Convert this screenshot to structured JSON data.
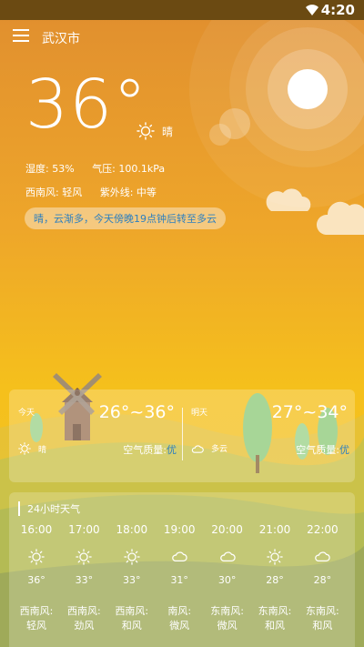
{
  "status": {
    "time": "4:20"
  },
  "header": {
    "city": "武汉市"
  },
  "current": {
    "temperature": "36°",
    "condition": "晴",
    "humidity": "湿度: 53%",
    "pressure": "气压: 100.1kPa",
    "wind": "西南风: 轻风",
    "uv": "紫外线: 中等",
    "tip": "晴，云渐多，今天傍晚19点钟后转至多云"
  },
  "today": {
    "label": "今天",
    "range": "26°~36°",
    "condition": "晴",
    "aq_label": "空气质量:",
    "aq_value": "优"
  },
  "tomorrow": {
    "label": "明天",
    "range": "27°~34°",
    "condition": "多云",
    "aq_label": "空气质量:",
    "aq_value": "优"
  },
  "hourly": {
    "title": "24小时天气",
    "items": [
      {
        "time": "16:00",
        "icon": "sun-icon",
        "temp": "36°",
        "wind_dir": "西南风:",
        "wind_lvl": "轻风"
      },
      {
        "time": "17:00",
        "icon": "sun-icon",
        "temp": "33°",
        "wind_dir": "西南风:",
        "wind_lvl": "劲风"
      },
      {
        "time": "18:00",
        "icon": "sun-icon",
        "temp": "33°",
        "wind_dir": "西南风:",
        "wind_lvl": "和风"
      },
      {
        "time": "19:00",
        "icon": "cloud-icon",
        "temp": "31°",
        "wind_dir": "南风:",
        "wind_lvl": "微风"
      },
      {
        "time": "20:00",
        "icon": "cloud-icon",
        "temp": "30°",
        "wind_dir": "东南风:",
        "wind_lvl": "微风"
      },
      {
        "time": "21:00",
        "icon": "sun-icon",
        "temp": "28°",
        "wind_dir": "东南风:",
        "wind_lvl": "和风"
      },
      {
        "time": "22:00",
        "icon": "cloud-icon",
        "temp": "28°",
        "wind_dir": "东南风:",
        "wind_lvl": "和风"
      }
    ]
  },
  "colors": {
    "sky_top": "#e49a2e",
    "sky_mid": "#f3b21a",
    "accent_blue": "#2c7fc0"
  }
}
